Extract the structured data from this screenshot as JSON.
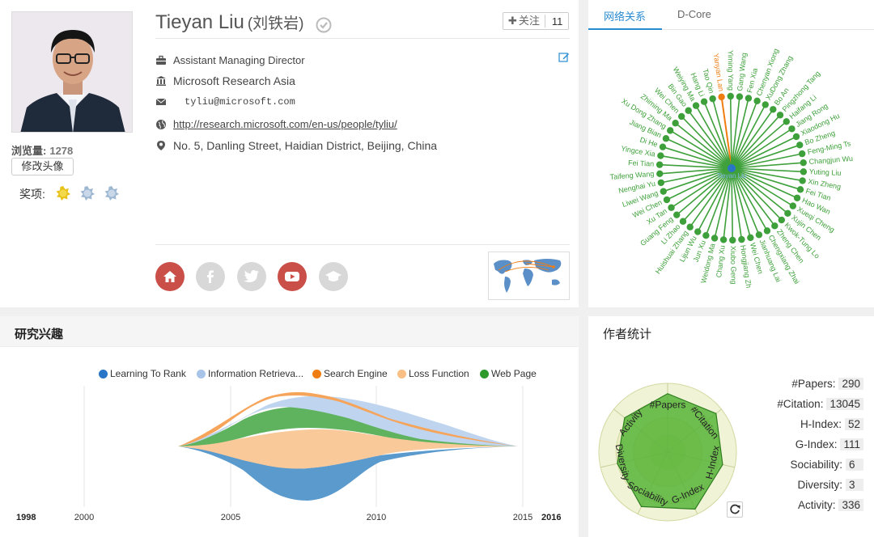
{
  "profile": {
    "name_en": "Tieyan Liu",
    "name_cn": "(刘铁岩)",
    "follow_label": "关注",
    "follow_count": "11",
    "views_label": "浏览量:",
    "views_count": "1278",
    "change_avatar_label": "修改头像",
    "awards_label": "奖项:",
    "position": "Assistant Managing Director",
    "affiliation": "Microsoft Research Asia",
    "email": "tyliu@microsoft.com",
    "homepage": "http://research.microsoft.com/en-us/people/tyliu/",
    "address": "No. 5, Danling Street, Haidian District, Beijing, China"
  },
  "network": {
    "tabs": [
      "网络关系",
      "D-Core"
    ],
    "center": "Tieyan Liu",
    "highlight": "Yanyan Lan",
    "nodes": [
      "Yanyan Lan",
      "Yiming Yang",
      "Gang Wang",
      "Fen Xia",
      "Chenyan Xiong",
      "XuDong Zhang",
      "Bo An",
      "Pingzhong Tang",
      "Haifang Li",
      "Jiang Rong",
      "Xiaodong Hu",
      "Bo Zheng",
      "Feng-Ming Ts",
      "Changjun Wu",
      "Yuting Liu",
      "Xin Zheng",
      "Fei Tian",
      "Hao Wan",
      "Xueqi Cheng",
      "Xujin Chen",
      "Kwok-Tung Lo",
      "Zheng Chen",
      "Chengxiang Zhai",
      "Jianhuang Lai",
      "Wei Chen",
      "Hongjiang Zh",
      "Xiubo Geng",
      "Chang Xu",
      "Weidong Ma",
      "Jun Xu",
      "Lijun Wu",
      "Huishuai Zhang",
      "Li Zhao",
      "Guang Feng",
      "Xu Tan",
      "Wei Chen",
      "Liwei Wang",
      "Nenghai Yu",
      "Taifeng Wang",
      "Fei Tian",
      "Yingce Xia",
      "Di He",
      "Jiang Bian",
      "Xu Dong Zhang",
      "Zhiming Ma",
      "Wei Chen",
      "Bin Gao",
      "Weiying Ma",
      "Hang Li",
      "Tao Qin"
    ],
    "colors": {
      "node": "#3ea03a",
      "highlight": "#f07d12",
      "center": "#2a76c6"
    }
  },
  "interests": {
    "title": "研究兴趣",
    "legend": [
      {
        "name": "Learning To Rank",
        "color": "#2a76c6"
      },
      {
        "name": "Information Retrieva...",
        "color": "#a8c4e8"
      },
      {
        "name": "Search Engine",
        "color": "#f07d12"
      },
      {
        "name": "Loss Function",
        "color": "#f9bf85"
      },
      {
        "name": "Web Page",
        "color": "#2e9a2e"
      }
    ],
    "axis_start": "1998",
    "axis_end": "2016",
    "ticks": [
      "2000",
      "2005",
      "2010",
      "2015"
    ]
  },
  "stats": {
    "title": "作者统计",
    "rows": [
      {
        "label": "#Papers:",
        "value": "290"
      },
      {
        "label": "#Citation:",
        "value": "13045"
      },
      {
        "label": "H-Index:",
        "value": "52"
      },
      {
        "label": "G-Index:",
        "value": "111"
      },
      {
        "label": "Sociability:",
        "value": "6"
      },
      {
        "label": "Diversity:",
        "value": "3"
      },
      {
        "label": "Activity:",
        "value": "336"
      }
    ],
    "radar_labels": [
      "#Papers",
      "#Citation",
      "H-Index",
      "G-Index",
      "Sociability",
      "Diversity",
      "Activity"
    ],
    "radar_values": [
      0.85,
      0.9,
      0.82,
      0.92,
      0.88,
      0.75,
      0.8
    ]
  }
}
